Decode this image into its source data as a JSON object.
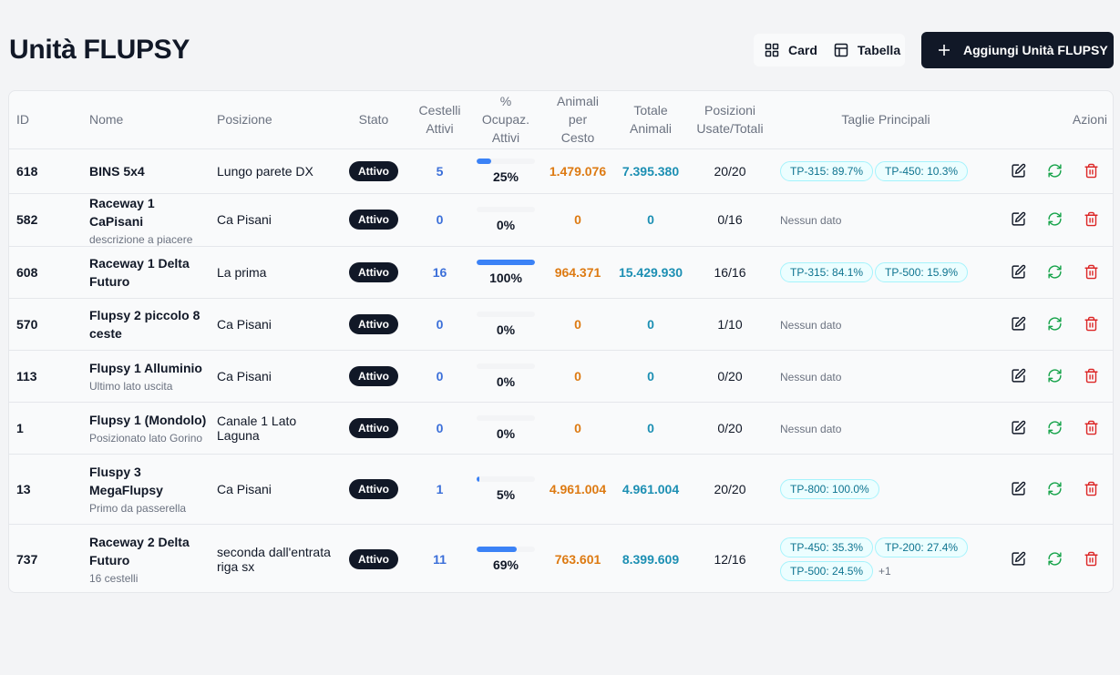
{
  "page": {
    "title": "Unità FLUPSY"
  },
  "toolbar": {
    "card_label": "Card",
    "table_label": "Tabella",
    "add_label": "Aggiungi Unità FLUPSY"
  },
  "table": {
    "headers": {
      "id": "ID",
      "name": "Nome",
      "position": "Posizione",
      "status": "Stato",
      "baskets_l1": "Cestelli",
      "baskets_l2": "Attivi",
      "occ_l1": "%",
      "occ_l2": "Ocupaz.",
      "occ_l3": "Attivi",
      "apb_l1": "Animali",
      "apb_l2": "per",
      "apb_l3": "Cesto",
      "tot_l1": "Totale",
      "tot_l2": "Animali",
      "pos_l1": "Posizioni",
      "pos_l2": "Usate/Totali",
      "sizes": "Taglie Principali",
      "actions": "Azioni"
    },
    "rows": [
      {
        "id": "618",
        "name": "BINS 5x4",
        "desc": "",
        "position": "Lungo parete DX",
        "status": "Attivo",
        "baskets": "5",
        "occupancy": 25,
        "occupancy_label": "25%",
        "animals_per_basket": "1.479.076",
        "total_animals": "7.395.380",
        "positions": "20/20",
        "sizes": [
          "TP-315: 89.7%",
          "TP-450: 10.3%"
        ],
        "sizes_more": "",
        "no_data": ""
      },
      {
        "id": "582",
        "name": "Raceway 1 CaPisani",
        "desc": "descrizione a piacere",
        "position": "Ca Pisani",
        "status": "Attivo",
        "baskets": "0",
        "occupancy": 0,
        "occupancy_label": "0%",
        "animals_per_basket": "0",
        "total_animals": "0",
        "positions": "0/16",
        "sizes": [],
        "sizes_more": "",
        "no_data": "Nessun dato"
      },
      {
        "id": "608",
        "name": "Raceway 1 Delta Futuro",
        "desc": "",
        "position": "La prima",
        "status": "Attivo",
        "baskets": "16",
        "occupancy": 100,
        "occupancy_label": "100%",
        "animals_per_basket": "964.371",
        "total_animals": "15.429.930",
        "positions": "16/16",
        "sizes": [
          "TP-315: 84.1%",
          "TP-500: 15.9%"
        ],
        "sizes_more": "",
        "no_data": ""
      },
      {
        "id": "570",
        "name": "Flupsy 2 piccolo 8 ceste",
        "desc": "",
        "position": "Ca Pisani",
        "status": "Attivo",
        "baskets": "0",
        "occupancy": 0,
        "occupancy_label": "0%",
        "animals_per_basket": "0",
        "total_animals": "0",
        "positions": "1/10",
        "sizes": [],
        "sizes_more": "",
        "no_data": "Nessun dato"
      },
      {
        "id": "113",
        "name": "Flupsy 1 Alluminio",
        "desc": "Ultimo lato uscita",
        "position": "Ca Pisani",
        "status": "Attivo",
        "baskets": "0",
        "occupancy": 0,
        "occupancy_label": "0%",
        "animals_per_basket": "0",
        "total_animals": "0",
        "positions": "0/20",
        "sizes": [],
        "sizes_more": "",
        "no_data": "Nessun dato"
      },
      {
        "id": "1",
        "name": "Flupsy 1 (Mondolo)",
        "desc": "Posizionato lato Gorino",
        "position": "Canale 1 Lato Laguna",
        "status": "Attivo",
        "baskets": "0",
        "occupancy": 0,
        "occupancy_label": "0%",
        "animals_per_basket": "0",
        "total_animals": "0",
        "positions": "0/20",
        "sizes": [],
        "sizes_more": "",
        "no_data": "Nessun dato"
      },
      {
        "id": "13",
        "name": "Fluspy 3 MegaFlupsy",
        "desc": "Primo da passerella",
        "position": "Ca Pisani",
        "status": "Attivo",
        "baskets": "1",
        "occupancy": 5,
        "occupancy_label": "5%",
        "animals_per_basket": "4.961.004",
        "total_animals": "4.961.004",
        "positions": "20/20",
        "sizes": [
          "TP-800: 100.0%"
        ],
        "sizes_more": "",
        "no_data": ""
      },
      {
        "id": "737",
        "name": "Raceway 2 Delta Futuro",
        "desc": "16 cestelli",
        "position": "seconda dall'entrata riga sx",
        "status": "Attivo",
        "baskets": "11",
        "occupancy": 69,
        "occupancy_label": "69%",
        "animals_per_basket": "763.601",
        "total_animals": "8.399.609",
        "positions": "12/16",
        "sizes": [
          "TP-450: 35.3%",
          "TP-200: 27.4%",
          "TP-500: 24.5%"
        ],
        "sizes_more": "+1",
        "no_data": ""
      }
    ]
  },
  "icons": {
    "card": "grid-icon",
    "table": "table-icon",
    "add": "plus-icon",
    "edit": "edit-icon",
    "refresh": "refresh-icon",
    "delete": "trash-icon"
  },
  "colors": {
    "primary": "#111827",
    "edit": "#111827",
    "refresh": "#16a34a",
    "delete": "#dc2626",
    "bar": "#3b82f6"
  }
}
